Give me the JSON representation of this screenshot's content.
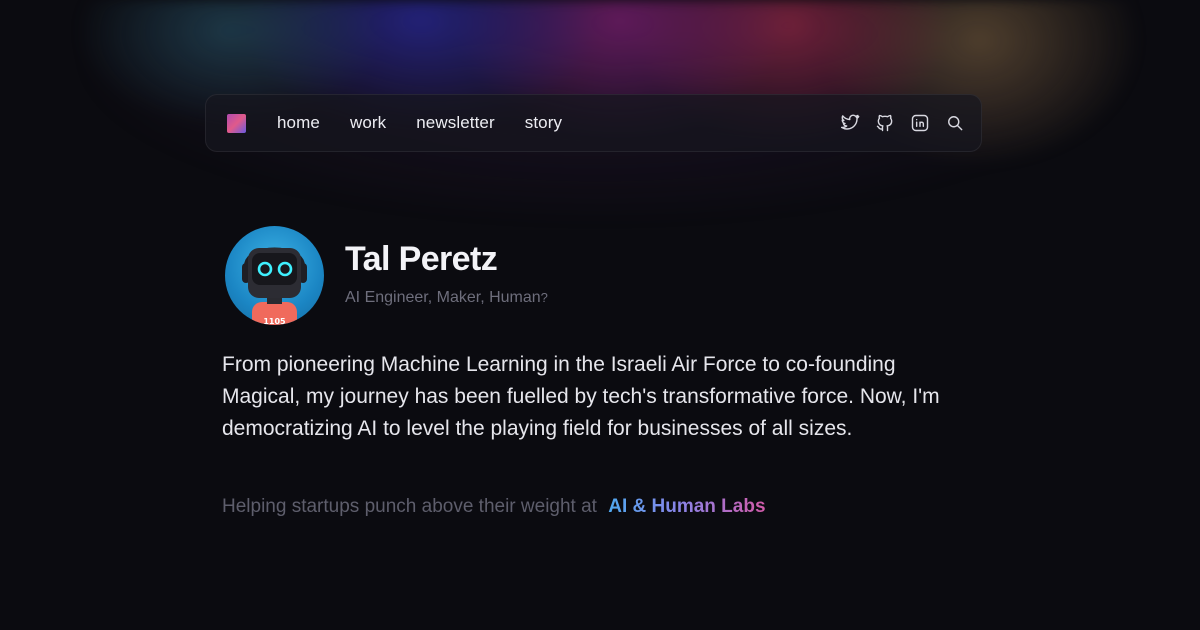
{
  "nav": {
    "links": [
      "home",
      "work",
      "newsletter",
      "story"
    ],
    "icons": [
      "twitter-icon",
      "github-icon",
      "linkedin-icon",
      "search-icon"
    ]
  },
  "profile": {
    "name": "Tal Peretz",
    "tagline": "AI Engineer, Maker, Human",
    "tagline_suffix": "?",
    "avatar_badge": "1105"
  },
  "bio": "From pioneering Machine Learning in the Israeli Air Force to co-founding Magical, my journey has been fuelled by tech's transformative force. Now, I'm democratizing AI to level the playing field for businesses of all sizes.",
  "footer": {
    "helping_text": "Helping startups punch above their weight at",
    "link_label": "AI & Human Labs"
  },
  "colors": {
    "background": "#0b0b10",
    "link_gradient": [
      "#4fa9f0",
      "#8a84e8",
      "#d25aa8"
    ]
  }
}
